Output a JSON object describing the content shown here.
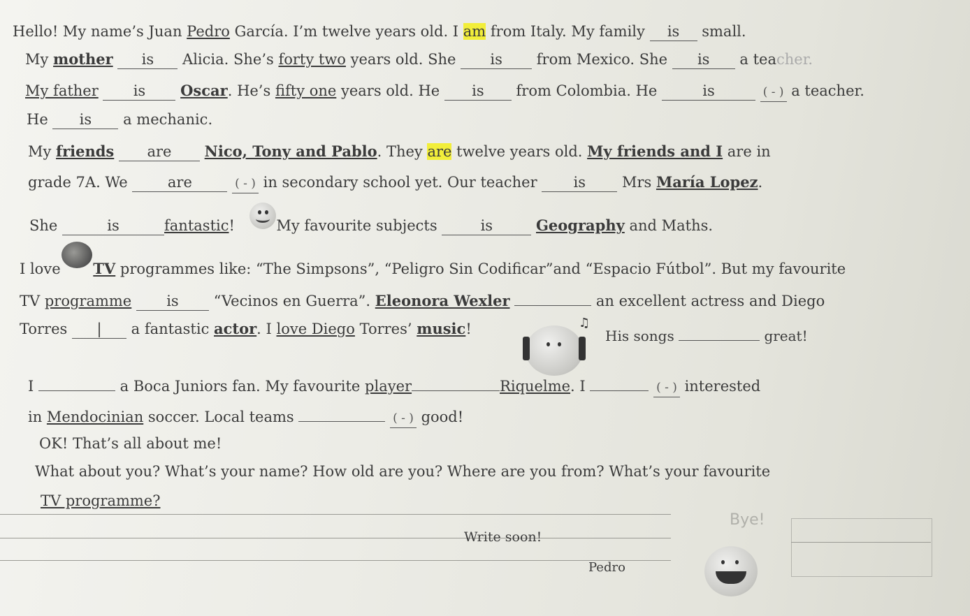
{
  "text": {
    "p1_l1": {
      "a": "Hello! My name’s Juan ",
      "pedro": "Pedro",
      "b": " García. I’m twelve years old. I ",
      "am": "am",
      "c": " from Italy. My family ",
      "blank": "is",
      "d": " small."
    },
    "p1_l2": {
      "a": "My ",
      "mother": "mother",
      "blank1": "is",
      "b": " Alicia. She’s ",
      "forty": "forty two",
      "c": " years old. She ",
      "blank2": "is",
      "d": " from Mexico. She ",
      "blank3": "is",
      "e": " a tea",
      "faded": "cher."
    },
    "p1_l3": {
      "father": "My  father",
      "blank1": "is",
      "oscar": "Oscar",
      "b": ". He’s ",
      "fifty": "fifty one",
      "c": " years old. He ",
      "blank2": "is",
      "d": " from Colombia. He ",
      "blank3": "is",
      "neg": "( - )",
      "e": " a teacher."
    },
    "p1_l4": {
      "a": "He ",
      "blank": "is",
      "b": " a mechanic."
    },
    "p2_l1": {
      "a": "My ",
      "friends": "friends",
      "blank": "are",
      "names": "Nico, Tony and Pablo",
      "b": ". They ",
      "are": "are",
      "c": " twelve years old. ",
      "mf": "My friends and I",
      "d": " are in"
    },
    "p2_l2": {
      "a": "grade 7A. We ",
      "blank1": "are",
      "neg": "( - )",
      "b": " in secondary school yet. Our teacher ",
      "blank2": "is",
      "c": " Mrs ",
      "maria": "María Lopez",
      "d": "."
    },
    "p2_l3": {
      "a": "She ",
      "blank1": "is",
      "fantastic": "fantastic",
      "b": "! ",
      "c": "My favourite subjects ",
      "blank2": "is",
      "geo": "Geography",
      "d": " and Maths."
    },
    "p3_l1": {
      "a": "I love ",
      "tv": "TV",
      "b": " programmes like: “The Simpsons”, “Peligro Sin Codificar”and “Espacio Fútbol”. But my favourite"
    },
    "p3_l2": {
      "a": "TV ",
      "programme": "programme",
      "blank1": "is",
      "b": " “Vecinos en Guerra”. ",
      "ew": "Eleonora Wexler",
      "blank2": "",
      "c": " an excellent actress and Diego"
    },
    "p3_l3": {
      "a": "Torres ",
      "blank1": "|",
      "b": " a fantastic ",
      "actor": "actor",
      "c": ". I ",
      "love": "love  Diego",
      "d": " Torres’ ",
      "music": "music",
      "e": "!",
      "f": "His songs ",
      "blank2": "",
      "g": " great!"
    },
    "p4_l1": {
      "a": "I ",
      "blank1": "",
      "b": " a Boca Juniors fan. My favourite ",
      "player": "player",
      "blank2": "",
      "riq": "Riquelme",
      "c": ".  I ",
      "blank3": "",
      "neg": "( - )",
      "d": " interested"
    },
    "p4_l2": {
      "a": "in ",
      "mendo": "Mendocinian",
      "b": " soccer. Local teams ",
      "blank": "",
      "neg": "( - )",
      "c": " good!"
    },
    "p5_l1": "OK! That’s all about me!",
    "p5_l2": "What about you? What’s your name? How old are you? Where are you from? What’s your favourite",
    "p5_l3": "TV  programme?",
    "bye": "Bye!",
    "write": "Write soon!",
    "sign": "Pedro"
  },
  "icons": [
    "smiley-icon",
    "sunglasses-smiley-icon",
    "headphones-smiley-icon",
    "music-note-icon",
    "laughing-smiley-icon"
  ]
}
